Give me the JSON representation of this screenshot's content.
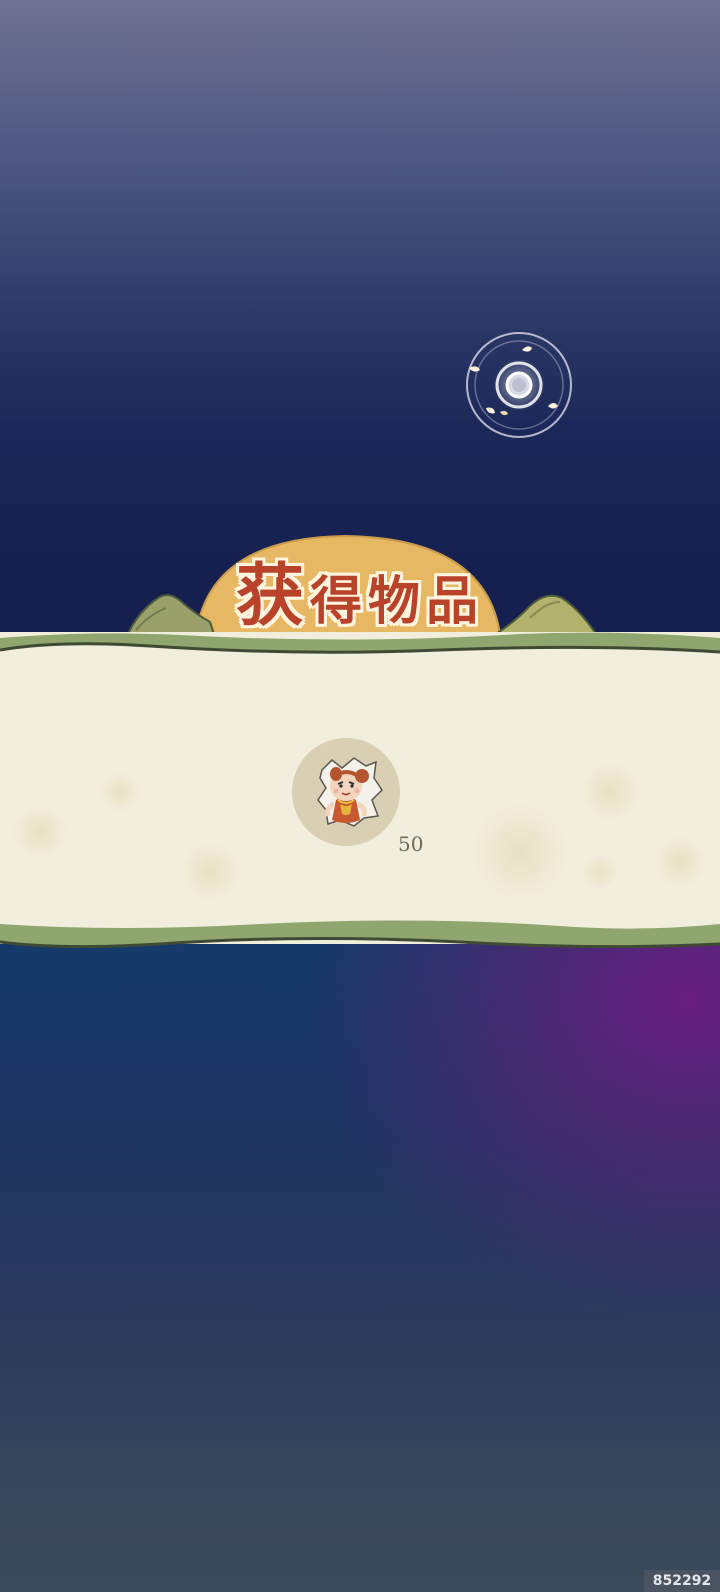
{
  "dialog": {
    "title_first_char": "获",
    "title_rest": "得物品"
  },
  "reward": {
    "item_icon": "child-character-icon",
    "count": "50"
  },
  "skip_button": {
    "icon": "spiral-circle-icon"
  },
  "watermark": {
    "text": "852292"
  },
  "colors": {
    "title_red": "#b8432a",
    "scroll_paper": "#f2eedd",
    "scroll_border": "#8fa66e",
    "sun_gold": "#e7b864"
  }
}
